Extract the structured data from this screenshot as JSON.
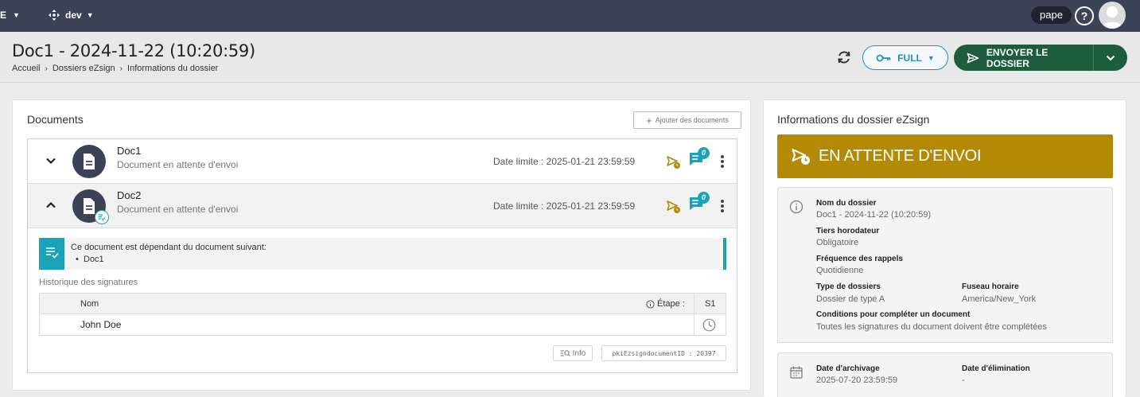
{
  "topbar": {
    "left_fragment": "E",
    "env_label": "dev",
    "username": "pape",
    "help_label": "?"
  },
  "header": {
    "title": "Doc1 - 2024-11-22 (10:20:59)",
    "breadcrumb": [
      "Accueil",
      "Dossiers eZsign",
      "Informations du dossier"
    ],
    "full_label": "FULL",
    "send_label": "ENVOYER LE DOSSIER"
  },
  "documents": {
    "title": "Documents",
    "add_label": "Ajouter des documents",
    "items": [
      {
        "name": "Doc1",
        "status": "Document en attente d'envoi",
        "deadline": "Date limite : 2025-01-21 23:59:59",
        "comments": "0"
      },
      {
        "name": "Doc2",
        "status": "Document en attente d'envoi",
        "deadline": "Date limite : 2025-01-21 23:59:59",
        "comments": "0"
      }
    ],
    "dependency_text": "Ce document est dépendant du document suivant:",
    "dependency_items": [
      "Doc1"
    ],
    "history_title": "Historique des signatures",
    "table": {
      "col_name": "Nom",
      "col_etape": "Étape :",
      "col_s1": "S1",
      "rows": [
        {
          "name": "John Doe"
        }
      ]
    },
    "info_label": "Info",
    "pki_label": "pkiEzsigndocumentID : 20397"
  },
  "folder_info": {
    "title": "Informations du dossier eZsign",
    "status_banner": "EN ATTENTE D'ENVOI",
    "status_color": "#b28a05",
    "fields": {
      "folder_name_label": "Nom du dossier",
      "folder_name": "Doc1 - 2024-11-22 (10:20:59)",
      "timestamp_label": "Tiers horodateur",
      "timestamp": "Obligatoire",
      "reminder_label": "Fréquence des rappels",
      "reminder": "Quotidienne",
      "type_label": "Type de dossiers",
      "type": "Dossier de type A",
      "timezone_label": "Fuseau horaire",
      "timezone": "America/New_York",
      "conditions_label": "Conditions pour compléter un document",
      "conditions": "Toutes les signatures du document doivent être complétées",
      "archive_label": "Date d'archivage",
      "archive": "2025-07-20 23:59:59",
      "elimination_label": "Date d'élimination",
      "elimination": "-"
    }
  },
  "colors": {
    "topbar": "#3d4356",
    "primary_blue": "#1e8fd2",
    "send_green": "#1e5c3e",
    "teal": "#1aa3b8",
    "status_gold": "#b28a05"
  }
}
